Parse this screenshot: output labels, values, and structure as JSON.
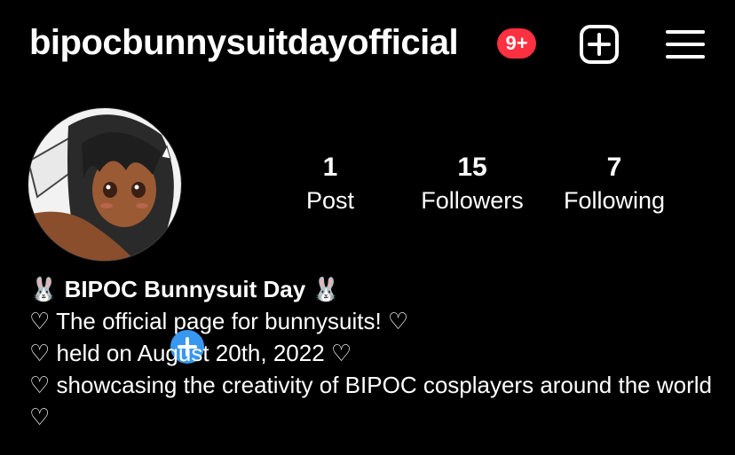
{
  "profile": {
    "username": "bipocbunnysuitdayofficial",
    "notification_badge": "9+",
    "display_name": "🐰 BIPOC Bunnysuit Day 🐰",
    "bio_lines": [
      "♡ The official page for bunnysuits! ♡",
      "♡ held on August 20th, 2022 ♡",
      "♡ showcasing the creativity of BIPOC cosplayers around the world ♡"
    ]
  },
  "stats": {
    "posts": {
      "value": "1",
      "label": "Post"
    },
    "followers": {
      "value": "15",
      "label": "Followers"
    },
    "following": {
      "value": "7",
      "label": "Following"
    }
  },
  "icons": {
    "new_post": "plus-square-icon",
    "menu": "hamburger-menu-icon",
    "add_story": "plus-icon"
  },
  "colors": {
    "background": "#000000",
    "text": "#ffffff",
    "badge": "#ff3040",
    "add_story": "#3897f0"
  }
}
